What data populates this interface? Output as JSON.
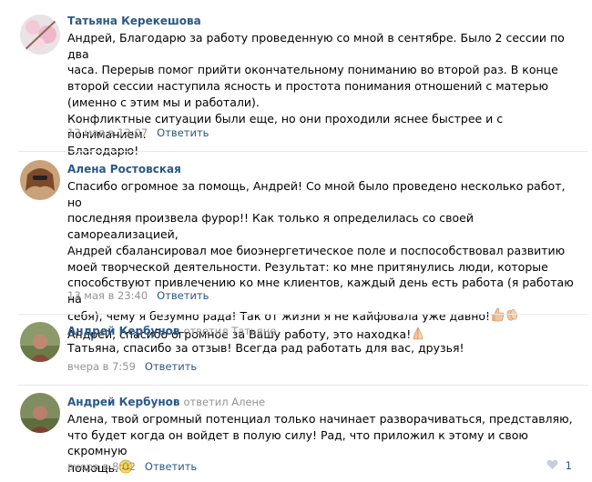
{
  "comments": [
    {
      "author": "Татьяна Керекешова",
      "reply_prefix": "",
      "reply_to": "",
      "text": "Андрей, Благодарю за работу проведенную со мной в сентябре. Было 2 сессии по два\nчаса. Перерыв помог прийти окончательному пониманию во второй раз. В конце\nвторой сессии наступила ясность и простота понимания отношений с матерью\n(именно с этим мы и работали).\nКонфликтные ситуации были еще, но они проходили яснее быстрее и с пониманием.\nБлагодарю!",
      "date": "13 мая в 13:07",
      "reply_label": "Ответить"
    },
    {
      "author": "Алена Ростовская",
      "reply_prefix": "",
      "reply_to": "",
      "text_lines": [
        "Спасибо огромное за помощь, Андрей! Со мной было проведено несколько работ, но",
        "последняя произвела фурор!! Как только я определилась со своей самореализацией,",
        "Андрей сбалансировал мое биоэнергетическое поле и поспособствовал развитию",
        "моей творческой деятельности. Результат: ко мне притянулись люди, которые",
        "способствуют привлечению ко мне клиентов, каждый день есть работа (я работаю на",
        "себя), чему я безумно рада! Так от жизни я не кайфовала уже давно!",
        "Андрей, спасибо огромное за Вашу работу, это находка!"
      ],
      "date": "13 мая в 23:40",
      "reply_label": "Ответить"
    },
    {
      "author": "Андрей Кербунов",
      "reply_prefix": "ответил",
      "reply_to": "Татьяне",
      "text": "Татьяна, спасибо за отзыв! Всегда рад работать для вас, друзья!",
      "date": "вчера в 7:59",
      "reply_label": "Ответить"
    },
    {
      "author": "Андрей Кербунов",
      "reply_prefix": "ответил",
      "reply_to": "Алене",
      "text": "Алена, твой огромный потенциал только начинает разворачиваться, представляю,\nчто будет когда он войдет в полую силу! Рад, что приложил к этому и свою скромную\nпомощь.",
      "date": "вчера в 8:02",
      "reply_label": "Ответить",
      "like_count": "1"
    }
  ],
  "icons": {
    "thumbs_up": "thumbs-up-emoji",
    "clap": "clapping-hands-emoji",
    "pray": "praying-hands-emoji",
    "smile": "smiling-face-emoji",
    "heart": "heart-icon"
  },
  "colors": {
    "link": "#2a5885",
    "meta": "#939393",
    "divider": "#e7e8ec"
  }
}
